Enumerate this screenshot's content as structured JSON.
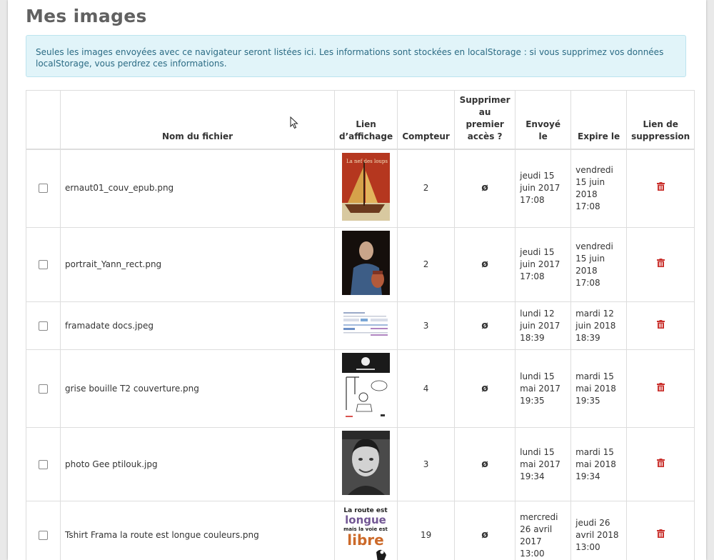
{
  "page": {
    "title": "Mes images",
    "info": "Seules les images envoyées avec ce navigateur seront listées ici. Les informations sont stockées en localStorage : si vous supprimez vos données localStorage, vous perdrez ces informations."
  },
  "table": {
    "headers": {
      "name": "Nom du fichier",
      "link": "Lien d’affichage",
      "counter": "Compteur",
      "delete_first": "Supprimer au premier accès ?",
      "sent": "Envoyé le",
      "expires": "Expire le",
      "delete_link": "Lien de suppression"
    },
    "delete_first_icon": "ø",
    "rows": [
      {
        "name": "ernaut01_couv_epub.png",
        "thumb_icon": "book-cover-thumbnail",
        "thumb_text": "La nef des loups",
        "counter": "2",
        "sent": "jeudi 15 juin 2017 17:08",
        "expires": "vendredi 15 juin 2018 17:08"
      },
      {
        "name": "portrait_Yann_rect.png",
        "thumb_icon": "portrait-thumbnail",
        "counter": "2",
        "sent": "jeudi 15 juin 2017 17:08",
        "expires": "vendredi 15 juin 2018 17:08"
      },
      {
        "name": "framadate docs.jpeg",
        "thumb_icon": "document-screenshot-thumbnail",
        "counter": "3",
        "sent": "lundi 12 juin 2017 18:39",
        "expires": "mardi 12 juin 2018 18:39"
      },
      {
        "name": "grise bouille T2 couverture.png",
        "thumb_icon": "comic-cover-thumbnail",
        "counter": "4",
        "sent": "lundi 15 mai 2017 19:35",
        "expires": "mardi 15 mai 2018 19:35"
      },
      {
        "name": "photo Gee ptilouk.jpg",
        "thumb_icon": "bw-portrait-thumbnail",
        "counter": "3",
        "sent": "lundi 15 mai 2017 19:34",
        "expires": "mardi 15 mai 2018 19:34"
      },
      {
        "name": "Tshirt Frama la route est longue couleurs.png",
        "thumb_icon": "tshirt-design-thumbnail",
        "thumb_text": {
          "line1": "La route est",
          "line2": "longue",
          "line3": "mais la voie est",
          "line4": "libre"
        },
        "counter": "19",
        "sent": "mercredi 26 avril 2017 13:00",
        "expires": "jeudi 26 avril 2018 13:00"
      }
    ]
  },
  "colors": {
    "title": "#616161",
    "info_bg": "#e1f4f9",
    "info_text": "#2b6b84",
    "trash": "#c9302c"
  }
}
